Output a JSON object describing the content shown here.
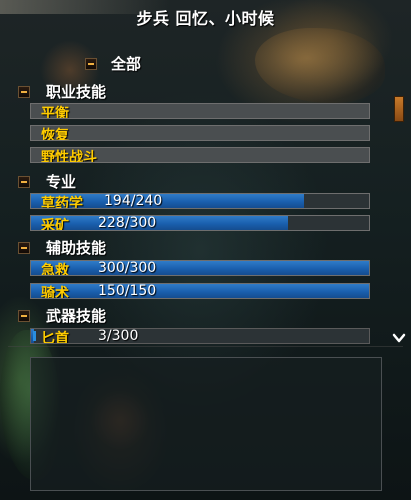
{
  "window": {
    "title": "步兵 回忆、小时候"
  },
  "tree": {
    "all_label": "全部",
    "groups": [
      {
        "label": "职业技能",
        "skills": [
          {
            "name": "平衡",
            "value": "",
            "fraction": 0
          },
          {
            "name": "恢复",
            "value": "",
            "fraction": 0
          },
          {
            "name": "野性战斗",
            "value": "",
            "fraction": 0
          }
        ]
      },
      {
        "label": "专业",
        "skills": [
          {
            "name": "草药学",
            "value": "194/240",
            "fraction": 0.808
          },
          {
            "name": "采矿",
            "value": "228/300",
            "fraction": 0.76
          }
        ]
      },
      {
        "label": "辅助技能",
        "skills": [
          {
            "name": "急救",
            "value": "300/300",
            "fraction": 1
          },
          {
            "name": "骑术",
            "value": "150/150",
            "fraction": 1
          }
        ]
      },
      {
        "label": "武器技能",
        "skills": [
          {
            "name": "匕首",
            "value": "3/300",
            "fraction": 0.01
          }
        ]
      }
    ]
  },
  "colors": {
    "skill_name": "#ffcc00",
    "bar_fill": "#1a5fae",
    "header_text": "#ffffff",
    "toggle_minus": "#f0b040"
  },
  "icons": {
    "collapse": "minus-toggle-icon",
    "scroll_down": "chevron-down-icon"
  }
}
